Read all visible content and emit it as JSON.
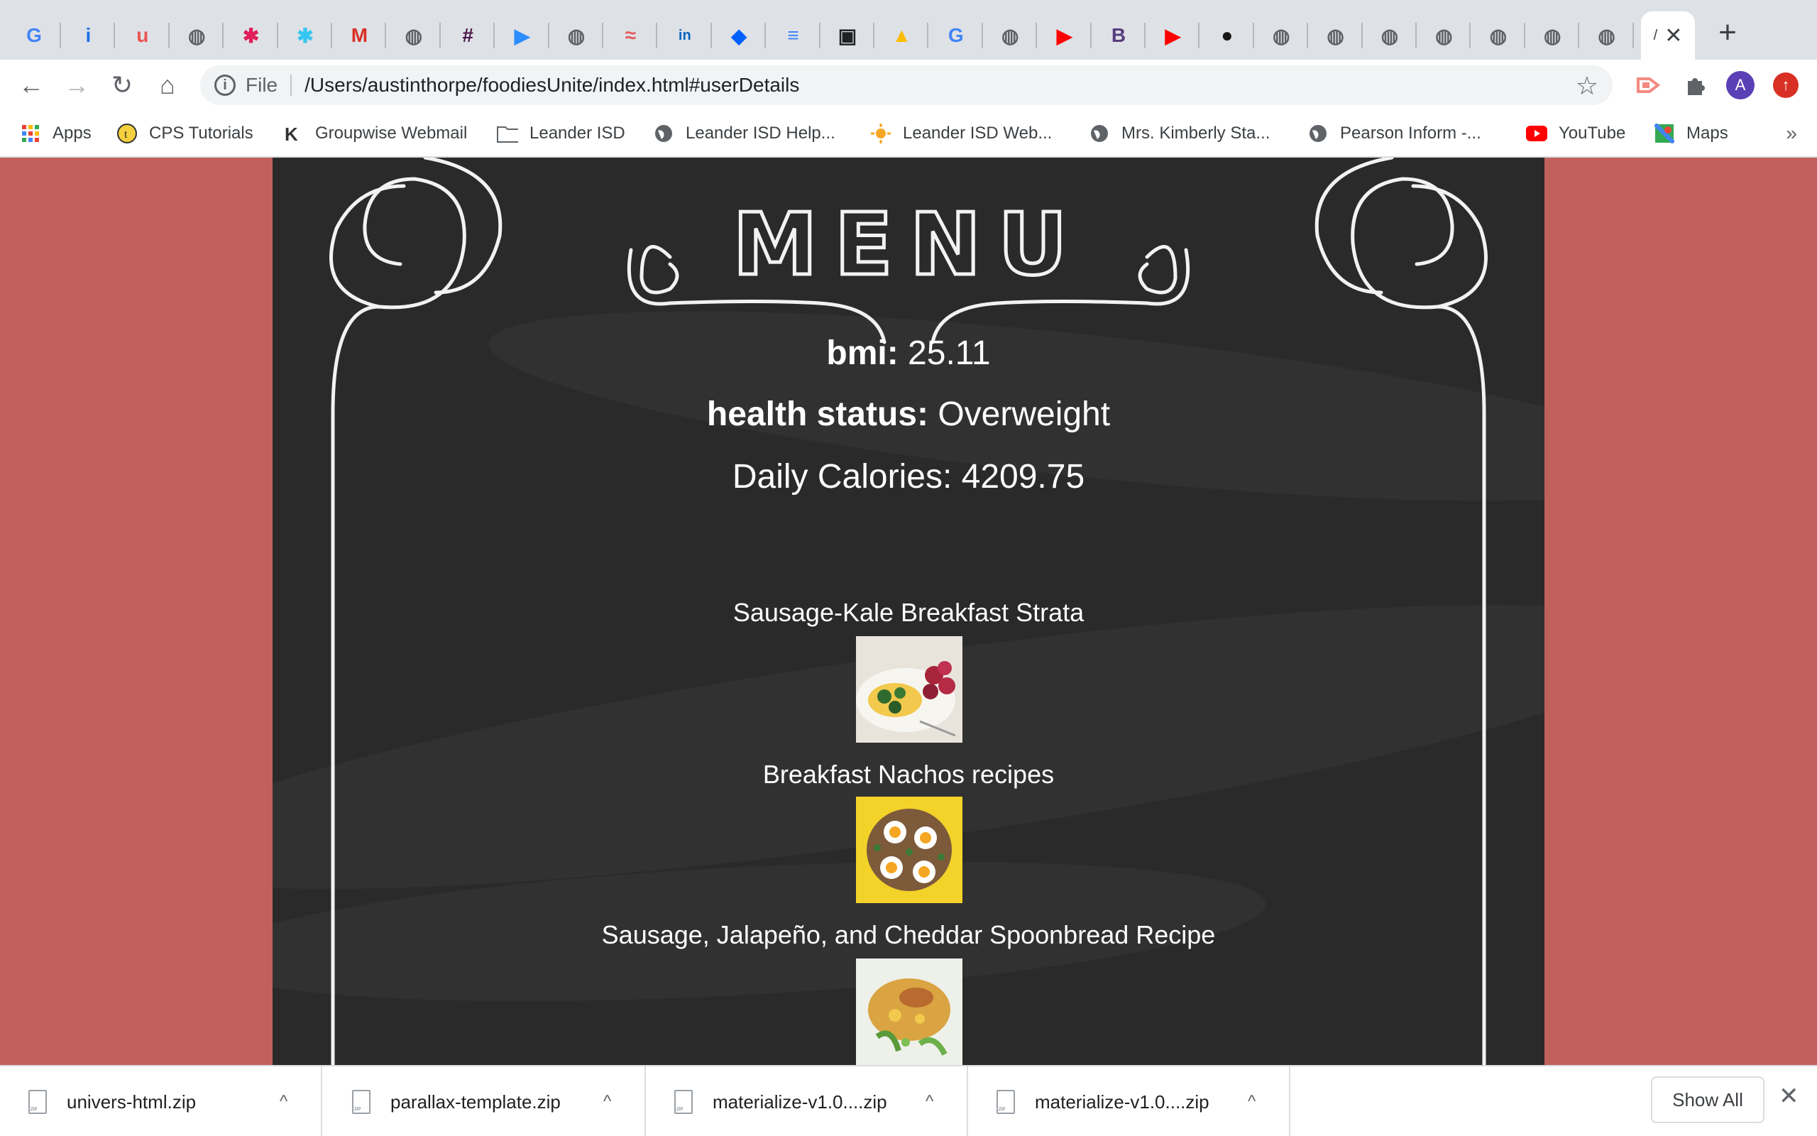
{
  "browser": {
    "tabs": [
      {
        "icon": "google-icon",
        "glyph": "G",
        "color": "#4285f4"
      },
      {
        "icon": "info-icon",
        "glyph": "i",
        "color": "#1a73e8"
      },
      {
        "icon": "udemy-icon",
        "glyph": "u",
        "color": "#ec5252"
      },
      {
        "icon": "globe-icon",
        "glyph": "◍",
        "color": "#5f6368"
      },
      {
        "icon": "slack-icon",
        "glyph": "✱",
        "color": "#e01e5a"
      },
      {
        "icon": "slack-icon",
        "glyph": "✱",
        "color": "#36c5f0"
      },
      {
        "icon": "gmail-icon",
        "glyph": "M",
        "color": "#d93025"
      },
      {
        "icon": "globe-icon",
        "glyph": "◍",
        "color": "#5f6368"
      },
      {
        "icon": "slack-icon",
        "glyph": "#",
        "color": "#4a154b"
      },
      {
        "icon": "zoom-icon",
        "glyph": "▶",
        "color": "#2d8cff"
      },
      {
        "icon": "globe-icon",
        "glyph": "◍",
        "color": "#5f6368"
      },
      {
        "icon": "app-icon",
        "glyph": "≈",
        "color": "#e65c5c"
      },
      {
        "icon": "linkedin-icon",
        "glyph": "in",
        "color": "#0a66c2"
      },
      {
        "icon": "dropbox-icon",
        "glyph": "◆",
        "color": "#0061fe"
      },
      {
        "icon": "docs-icon",
        "glyph": "≡",
        "color": "#4285f4"
      },
      {
        "icon": "app-icon",
        "glyph": "▣",
        "color": "#202124"
      },
      {
        "icon": "drive-icon",
        "glyph": "▲",
        "color": "#fbbc04"
      },
      {
        "icon": "google-icon",
        "glyph": "G",
        "color": "#4285f4"
      },
      {
        "icon": "globe-icon",
        "glyph": "◍",
        "color": "#5f6368"
      },
      {
        "icon": "youtube-icon",
        "glyph": "▶",
        "color": "#ff0000"
      },
      {
        "icon": "bootstrap-icon",
        "glyph": "B",
        "color": "#563d7c"
      },
      {
        "icon": "youtube-icon",
        "glyph": "▶",
        "color": "#ff0000"
      },
      {
        "icon": "github-icon",
        "glyph": "●",
        "color": "#181717"
      },
      {
        "icon": "globe-icon",
        "glyph": "◍",
        "color": "#5f6368"
      },
      {
        "icon": "globe-icon",
        "glyph": "◍",
        "color": "#5f6368"
      },
      {
        "icon": "globe-icon",
        "glyph": "◍",
        "color": "#5f6368"
      },
      {
        "icon": "globe-icon",
        "glyph": "◍",
        "color": "#5f6368"
      },
      {
        "icon": "globe-icon",
        "glyph": "◍",
        "color": "#5f6368"
      },
      {
        "icon": "globe-icon",
        "glyph": "◍",
        "color": "#5f6368"
      },
      {
        "icon": "globe-icon",
        "glyph": "◍",
        "color": "#5f6368"
      }
    ],
    "active_tab_text": "/",
    "active_tab_close": "✕",
    "new_tab": "+",
    "back": "←",
    "forward": "→",
    "reload": "↻",
    "home": "⌂",
    "address_scheme": "File",
    "address_url": "/Users/austinthorpe/foodiesUnite/index.html#userDetails",
    "profile_initial": "A",
    "colors": {
      "profile": "#5b3fb5",
      "update": "#d93025",
      "ext_red": "#f28b82"
    }
  },
  "bookmarks": [
    {
      "label": "Apps",
      "icon": "apps-grid-icon"
    },
    {
      "label": "CPS Tutorials",
      "icon": "cps-icon"
    },
    {
      "label": "Groupwise Webmail",
      "icon": "groupwise-icon"
    },
    {
      "label": "Leander ISD",
      "icon": "folder-icon"
    },
    {
      "label": "Leander ISD Help...",
      "icon": "globe-icon"
    },
    {
      "label": "Leander ISD Web...",
      "icon": "sun-icon"
    },
    {
      "label": "Mrs. Kimberly Sta...",
      "icon": "globe-icon"
    },
    {
      "label": "Pearson Inform -...",
      "icon": "globe-icon"
    },
    {
      "label": "YouTube",
      "icon": "youtube-icon"
    },
    {
      "label": "Maps",
      "icon": "maps-icon"
    }
  ],
  "bookmarks_more": "»",
  "menu": {
    "heading": "MENU",
    "bmi_label": "bmi:",
    "bmi_value": "25.11",
    "status_label": "health status:",
    "status_value": "Overweight",
    "calories_label": "Daily Calories:",
    "calories_value": "4209.75"
  },
  "recipes": [
    {
      "title": "Sausage-Kale Breakfast Strata"
    },
    {
      "title": "Breakfast Nachos recipes"
    },
    {
      "title": "Sausage, Jalapeño, and Cheddar Spoonbread Recipe"
    }
  ],
  "downloads": [
    {
      "name": "univers-html.zip"
    },
    {
      "name": "parallax-template.zip"
    },
    {
      "name": "materialize-v1.0....zip"
    },
    {
      "name": "materialize-v1.0....zip"
    }
  ],
  "download_caret": "^",
  "show_all": "Show All",
  "shelf_close": "✕"
}
